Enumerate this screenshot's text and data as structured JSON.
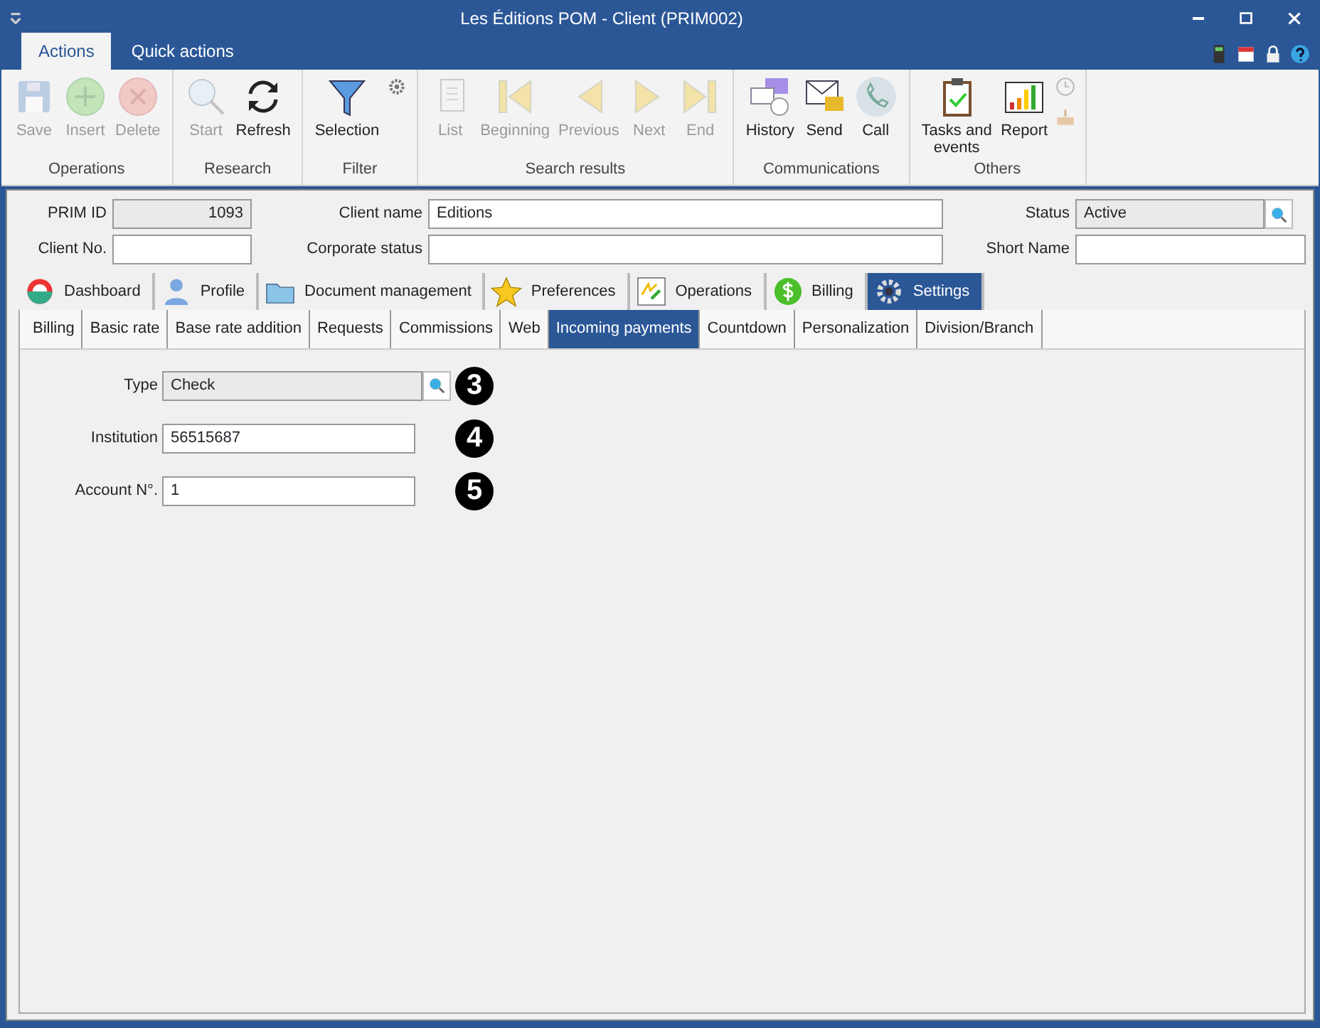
{
  "window": {
    "title": "Les Éditions POM - Client (PRIM002)"
  },
  "ribbon_tabs": [
    {
      "label": "Actions",
      "selected": true
    },
    {
      "label": "Quick actions",
      "selected": false
    }
  ],
  "ribbon_groups": [
    {
      "label": "Operations",
      "buttons": [
        {
          "label": "Save",
          "disabled": true
        },
        {
          "label": "Insert",
          "disabled": true
        },
        {
          "label": "Delete",
          "disabled": true
        }
      ]
    },
    {
      "label": "Research",
      "buttons": [
        {
          "label": "Start",
          "disabled": true
        },
        {
          "label": "Refresh",
          "disabled": false
        }
      ]
    },
    {
      "label": "Filter",
      "buttons": [
        {
          "label": "Selection",
          "disabled": false
        }
      ]
    },
    {
      "label": "Search results",
      "buttons": [
        {
          "label": "List",
          "disabled": true
        },
        {
          "label": "Beginning",
          "disabled": true
        },
        {
          "label": "Previous",
          "disabled": true
        },
        {
          "label": "Next",
          "disabled": true
        },
        {
          "label": "End",
          "disabled": true
        }
      ]
    },
    {
      "label": "Communications",
      "buttons": [
        {
          "label": "History",
          "disabled": false
        },
        {
          "label": "Send",
          "disabled": false
        },
        {
          "label": "Call",
          "disabled": false
        }
      ]
    },
    {
      "label": "Others",
      "buttons": [
        {
          "label": "Tasks and events",
          "disabled": false
        },
        {
          "label": "Report",
          "disabled": false
        }
      ]
    }
  ],
  "header_fields": [
    {
      "label": "PRIM ID",
      "value": "1093",
      "kind": "readonly"
    },
    {
      "label": "Client name",
      "value": "Editions",
      "kind": "text"
    },
    {
      "label": "Status",
      "value": "Active",
      "kind": "lookup"
    },
    {
      "label": "Client No.",
      "kind": "text"
    },
    {
      "label": "Corporate status",
      "kind": "text"
    },
    {
      "label": "Short Name",
      "kind": "text"
    }
  ],
  "main_tabs": [
    {
      "label": "Dashboard",
      "selected": false
    },
    {
      "label": "Profile",
      "selected": false
    },
    {
      "label": "Document management",
      "selected": false
    },
    {
      "label": "Preferences",
      "selected": false
    },
    {
      "label": "Operations",
      "selected": false
    },
    {
      "label": "Billing",
      "selected": false
    },
    {
      "label": "Settings",
      "selected": true
    }
  ],
  "sub_tabs": [
    {
      "label": "Billing",
      "selected": false
    },
    {
      "label": "Basic rate",
      "selected": false
    },
    {
      "label": "Base rate addition",
      "selected": false
    },
    {
      "label": "Requests",
      "selected": false
    },
    {
      "label": "Commissions",
      "selected": false
    },
    {
      "label": "Web",
      "selected": false
    },
    {
      "label": "Incoming payments",
      "selected": true
    },
    {
      "label": "Countdown",
      "selected": false
    },
    {
      "label": "Personalization",
      "selected": false
    },
    {
      "label": "Division/Branch",
      "selected": false
    }
  ],
  "form_fields": [
    {
      "label": "Type",
      "value": "Check",
      "kind": "lookup",
      "callout": "3"
    },
    {
      "label": "Institution",
      "value": "56515687",
      "kind": "text",
      "callout": "4"
    },
    {
      "label": "Account N°.",
      "value": "1",
      "kind": "text",
      "callout": "5"
    }
  ]
}
